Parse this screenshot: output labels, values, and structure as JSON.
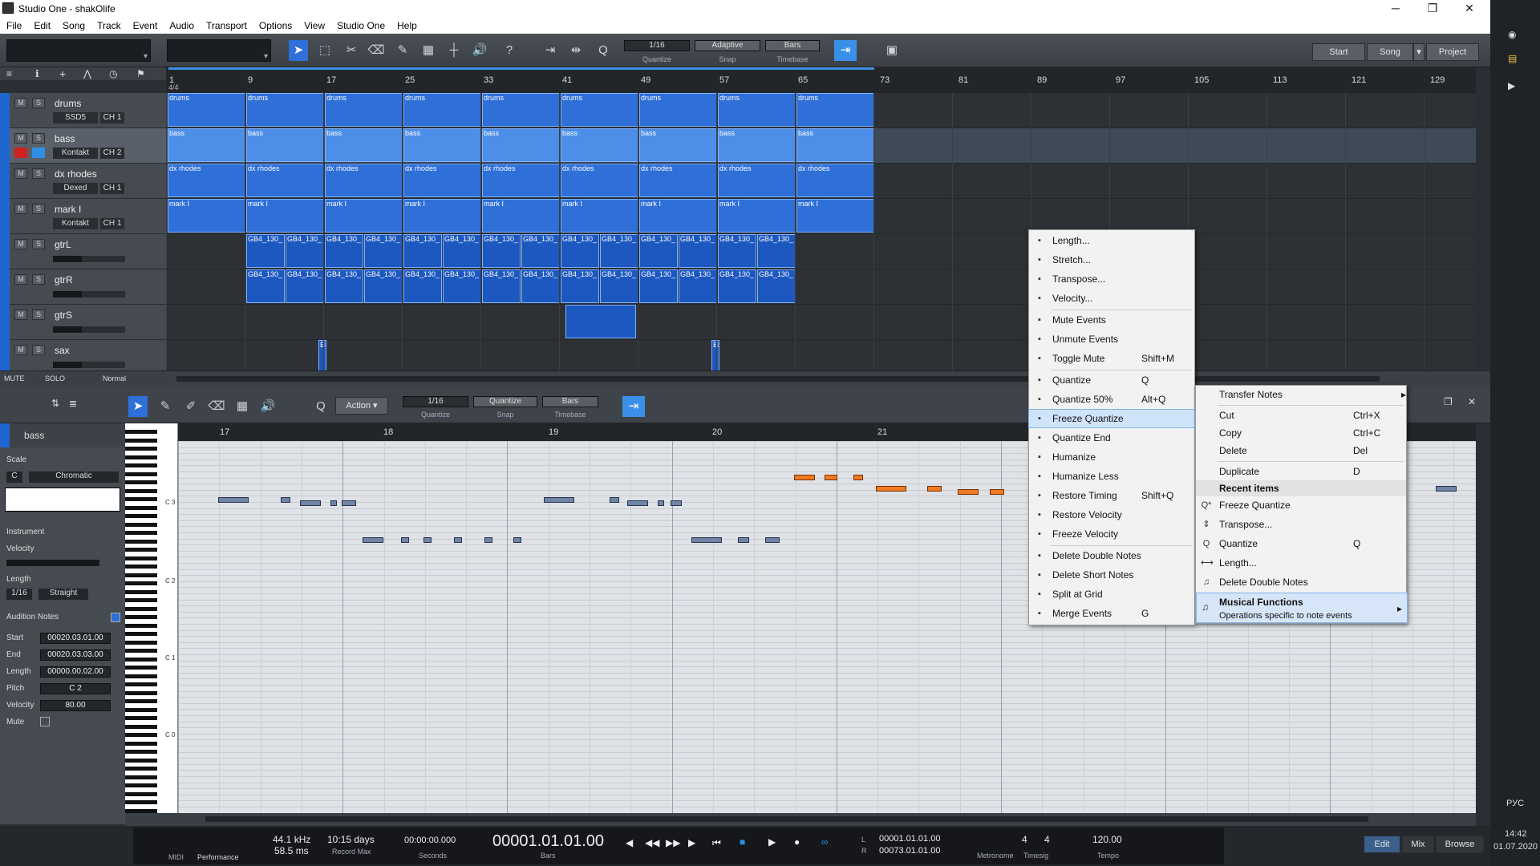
{
  "window": {
    "title": "Studio One - shakOlife",
    "minimize": "─",
    "maximize": "❐",
    "close": "✕"
  },
  "menu": [
    "File",
    "Edit",
    "Song",
    "Track",
    "Event",
    "Audio",
    "Transport",
    "Options",
    "View",
    "Studio One",
    "Help"
  ],
  "toolbar": {
    "quantize_value": "1/16",
    "quantize_label": "Quantize",
    "snap_mode": "Adaptive",
    "snap_label": "Snap",
    "timebase_value": "Bars",
    "timebase_label": "Timebase",
    "nav": [
      "Start",
      "Song",
      "Project"
    ]
  },
  "ruler": {
    "time_signature": "4/4",
    "marks": [
      "1",
      "9",
      "17",
      "25",
      "33",
      "41",
      "49",
      "57",
      "65",
      "73",
      "81",
      "89",
      "97",
      "105",
      "113",
      "121",
      "129"
    ]
  },
  "tracks": [
    {
      "name": "drums",
      "mute": "M",
      "solo": "S",
      "instrument": "SSD5",
      "channel": "CH 1",
      "type": "instrument"
    },
    {
      "name": "bass",
      "mute": "M",
      "solo": "S",
      "instrument": "Kontakt",
      "channel": "CH 2",
      "type": "instrument",
      "selected": true
    },
    {
      "name": "dx rhodes",
      "mute": "M",
      "solo": "S",
      "instrument": "Dexed",
      "channel": "CH 1",
      "type": "instrument"
    },
    {
      "name": "mark I",
      "mute": "M",
      "solo": "S",
      "instrument": "Kontakt",
      "channel": "CH 1",
      "type": "instrument"
    },
    {
      "name": "gtrL",
      "mute": "M",
      "solo": "S",
      "type": "audio"
    },
    {
      "name": "gtrR",
      "mute": "M",
      "solo": "S",
      "type": "audio"
    },
    {
      "name": "gtrS",
      "mute": "M",
      "solo": "S",
      "type": "audio"
    },
    {
      "name": "sax",
      "mute": "M",
      "solo": "S",
      "type": "audio"
    }
  ],
  "clips": {
    "drums": "drums",
    "bass": "bass",
    "dx_rhodes": "dx rhodes",
    "mark_I": "mark I",
    "gtr_clip": "GB4_130_",
    "sax_clip": "BE"
  },
  "arrange_footer": {
    "mute": "MUTE",
    "solo": "SOLO",
    "mode": "Normal"
  },
  "editor_toolbar": {
    "action": "Action",
    "quantize_value": "1/16",
    "quantize_label": "Quantize",
    "snap_value": "Quantize",
    "snap_label": "Snap",
    "timebase_value": "Bars",
    "timebase_label": "Timebase"
  },
  "inspector": {
    "track": "bass",
    "scale_label": "Scale",
    "scale_root": "C",
    "scale_type": "Chromatic",
    "instrument_label": "Instrument",
    "velocity_label": "Velocity",
    "length_label": "Length",
    "length_value": "1/16",
    "length_mode": "Straight",
    "audition_label": "Audition Notes",
    "start_label": "Start",
    "start_value": "00020.03.01.00",
    "end_label": "End",
    "end_value": "00020.03.03.00",
    "len_label": "Length",
    "len_value": "00000.00.02.00",
    "pitch_label": "Pitch",
    "pitch_value": "C 2",
    "vel_label": "Velocity",
    "vel_value": "80.00",
    "mute_label": "Mute"
  },
  "piano_ruler": [
    "17",
    "18",
    "19",
    "20",
    "21"
  ],
  "keyboard_labels": [
    "C 3",
    "C 2",
    "C 1",
    "C 0"
  ],
  "context_menu_main": [
    {
      "label": "Length...",
      "icon": "length-icon",
      "shortcut": ""
    },
    {
      "label": "Stretch...",
      "icon": "stretch-icon",
      "shortcut": ""
    },
    {
      "label": "Transpose...",
      "icon": "transpose-icon",
      "shortcut": ""
    },
    {
      "label": "Velocity...",
      "icon": "velocity-icon",
      "shortcut": ""
    },
    {
      "label": "Mute Events",
      "icon": "mute-events-icon",
      "shortcut": ""
    },
    {
      "label": "Unmute Events",
      "icon": "unmute-events-icon",
      "shortcut": ""
    },
    {
      "label": "Toggle Mute",
      "icon": "toggle-mute-icon",
      "shortcut": "Shift+M"
    },
    {
      "label": "Quantize",
      "icon": "quantize-icon",
      "shortcut": "Q"
    },
    {
      "label": "Quantize 50%",
      "icon": "quantize-50-icon",
      "shortcut": "Alt+Q"
    },
    {
      "label": "Freeze Quantize",
      "icon": "freeze-quantize-icon",
      "shortcut": ""
    },
    {
      "label": "Quantize End",
      "icon": "quantize-end-icon",
      "shortcut": ""
    },
    {
      "label": "Humanize",
      "icon": "humanize-icon",
      "shortcut": ""
    },
    {
      "label": "Humanize Less",
      "icon": "humanize-less-icon",
      "shortcut": ""
    },
    {
      "label": "Restore Timing",
      "icon": "restore-timing-icon",
      "shortcut": "Shift+Q"
    },
    {
      "label": "Restore Velocity",
      "icon": "restore-velocity-icon",
      "shortcut": ""
    },
    {
      "label": "Freeze Velocity",
      "icon": "freeze-velocity-icon",
      "shortcut": ""
    },
    {
      "label": "Delete Double Notes",
      "icon": "delete-double-notes-icon",
      "shortcut": ""
    },
    {
      "label": "Delete Short Notes",
      "icon": "delete-short-notes-icon",
      "shortcut": ""
    },
    {
      "label": "Split at Grid",
      "icon": "split-grid-icon",
      "shortcut": ""
    },
    {
      "label": "Merge Events",
      "icon": "merge-events-icon",
      "shortcut": "G"
    }
  ],
  "context_menu_secondary": {
    "transfer_notes": "Transfer Notes",
    "cut": "Cut",
    "cut_sc": "Ctrl+X",
    "copy": "Copy",
    "copy_sc": "Ctrl+C",
    "delete": "Delete",
    "delete_sc": "Del",
    "duplicate": "Duplicate",
    "duplicate_sc": "D",
    "recent_items": "Recent items",
    "recent": [
      {
        "label": "Freeze Quantize",
        "shortcut": ""
      },
      {
        "label": "Transpose...",
        "shortcut": ""
      },
      {
        "label": "Quantize",
        "shortcut": "Q"
      },
      {
        "label": "Length...",
        "shortcut": ""
      },
      {
        "label": "Delete Double Notes",
        "shortcut": ""
      }
    ],
    "musical_functions": "Musical Functions",
    "musical_functions_desc": "Operations specific to note events"
  },
  "transport": {
    "midi": "MIDI",
    "performance": "Performance",
    "sample_rate": "44.1 kHz",
    "latency": "58.5 ms",
    "record_max_value": "10:15 days",
    "record_max_label": "Record Max",
    "seconds_value": "00:00:00.000",
    "seconds_label": "Seconds",
    "bars_value": "00001.01.01.00",
    "bars_label": "Bars",
    "loop_start": "00001.01.01.00",
    "loop_end": "00073.01.01.00",
    "loop_l": "L",
    "loop_r": "R",
    "metronome_label": "Metronome",
    "timesig_num": "4",
    "timesig_den": "4",
    "timesig_label": "Timesig",
    "tempo_value": "120.00",
    "tempo_label": "Tempo",
    "edit": "Edit",
    "mix": "Mix",
    "browse": "Browse"
  },
  "system": {
    "lang": "РУС",
    "time": "14:42",
    "date": "01.07.2020"
  },
  "colors": {
    "accent": "#1e66d0",
    "selected_note": "#f07a22",
    "note": "#6f84a6"
  }
}
